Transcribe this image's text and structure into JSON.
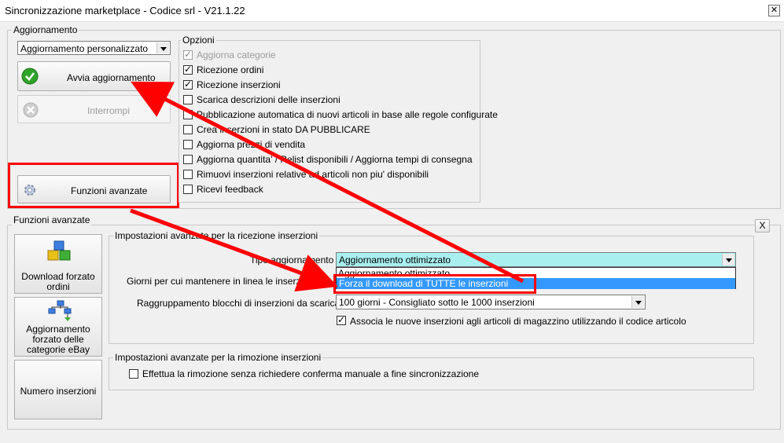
{
  "window": {
    "title": "Sincronizzazione marketplace - Codice srl - V21.1.22",
    "close_glyph": "✕"
  },
  "aggiornamento": {
    "legend": "Aggiornamento",
    "mode_combo_value": "Aggiornamento personalizzato",
    "start_button": "Avvia aggiornamento",
    "stop_button": "Interrompi",
    "advanced_button": "Funzioni avanzate"
  },
  "opzioni": {
    "legend": "Opzioni",
    "items": [
      {
        "label": "Aggiorna categorie",
        "checked": true,
        "disabled": true
      },
      {
        "label": "Ricezione ordini",
        "checked": true,
        "disabled": false
      },
      {
        "label": "Ricezione inserzioni",
        "checked": true,
        "disabled": false
      },
      {
        "label": "Scarica descrizioni delle inserzioni",
        "checked": false,
        "disabled": false
      },
      {
        "label": "Pubblicazione automatica di nuovi articoli in base alle regole configurate",
        "checked": false,
        "disabled": false
      },
      {
        "label": "Crea inserzioni in stato DA PUBBLICARE",
        "checked": false,
        "disabled": false
      },
      {
        "label": "Aggiorna prezzi di vendita",
        "checked": false,
        "disabled": false
      },
      {
        "label": "Aggiorna quantita' / Relist disponibili / Aggiorna tempi di consegna",
        "checked": false,
        "disabled": false
      },
      {
        "label": "Rimuovi inserzioni relative ad articoli non piu' disponibili",
        "checked": false,
        "disabled": false
      },
      {
        "label": "Ricevi feedback",
        "checked": false,
        "disabled": false
      }
    ]
  },
  "funzioni_avanzate": {
    "legend": "Funzioni avanzate",
    "close_button": "X",
    "side_buttons": [
      {
        "label_lines": [
          "Download forzato",
          "ordini"
        ]
      },
      {
        "label_lines": [
          "Aggiornamento",
          "forzato delle",
          "categorie eBay"
        ]
      },
      {
        "label_lines": [
          "Numero inserzioni"
        ]
      }
    ],
    "ricezione": {
      "legend": "Impostazioni avanzate per la ricezione inserzioni",
      "tipo_label": "Tipo aggiornamento :",
      "tipo_value": "Aggiornamento ottimizzato",
      "dropdown_options": [
        "Aggiornamento ottimizzato",
        "Forza il download di TUTTE le inserzioni"
      ],
      "giorni_label": "Giorni per cui mantenere in linea le inserzioni scaduto",
      "raggruppamento_label": "Raggruppamento blocchi di inserzioni da scaricare :",
      "raggruppamento_value": "100 giorni - Consigliato sotto le 1000 inserzioni",
      "associa_label": "Associa le nuove inserzioni agli articoli di magazzino utilizzando il codice articolo",
      "associa_checked": true
    },
    "rimozione": {
      "legend": "Impostazioni avanzate per la rimozione inserzioni",
      "effettua_label": "Effettua la rimozione senza richiedere conferma manuale a fine sincronizzazione",
      "effettua_checked": false
    }
  },
  "colors": {
    "highlight_red": "#ff0000",
    "combo_highlight": "#a9eff0",
    "selection_blue": "#3399ff"
  },
  "icons": {
    "start": "check-circle-icon",
    "stop": "stop-gear-icon",
    "advanced": "gear-icon",
    "download_orders": "boxes-icon",
    "update_categories": "tree-icon"
  }
}
